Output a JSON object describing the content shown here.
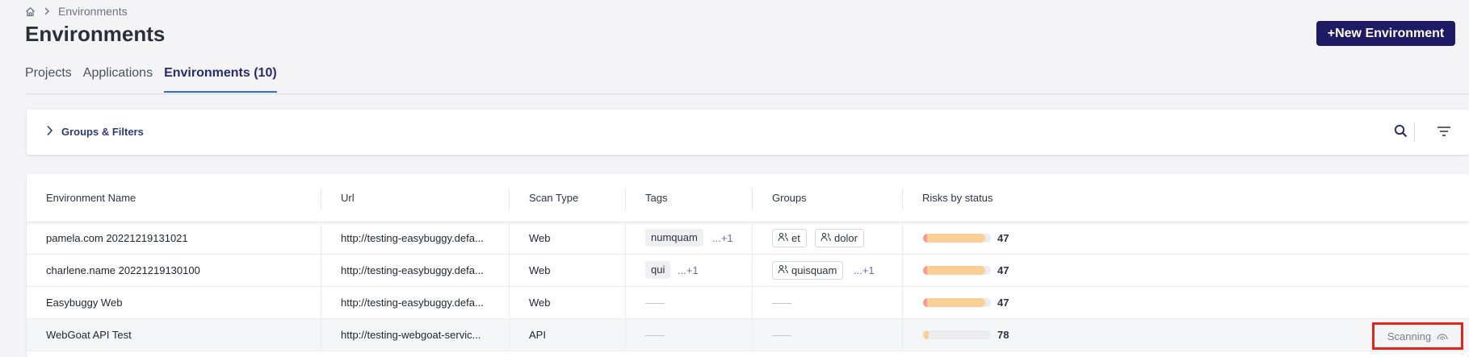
{
  "breadcrumb": {
    "current": "Environments"
  },
  "page": {
    "title": "Environments"
  },
  "toolbar": {
    "new_environment_label": "+New Environment"
  },
  "tabs": [
    {
      "label": "Projects",
      "active": false
    },
    {
      "label": "Applications",
      "active": false
    },
    {
      "label": "Environments (10)",
      "active": true
    }
  ],
  "filters": {
    "label": "Groups & Filters"
  },
  "table": {
    "columns": [
      "Environment Name",
      "Url",
      "Scan Type",
      "Tags",
      "Groups",
      "Risks by status"
    ],
    "rows": [
      {
        "name": "pamela.com 20221219131021",
        "url": "http://testing-easybuggy.defa...",
        "scan_type": "Web",
        "tags": [
          "numquam"
        ],
        "tags_more": "...+1",
        "groups": [
          "et",
          "dolor"
        ],
        "groups_more": "",
        "risk_fill": 0.92,
        "risk_red": 0.06,
        "risk_count": "47"
      },
      {
        "name": "charlene.name 20221219130100",
        "url": "http://testing-easybuggy.defa...",
        "scan_type": "Web",
        "tags": [
          "qui"
        ],
        "tags_more": "...+1",
        "groups": [
          "quisquam"
        ],
        "groups_more": "...+1",
        "risk_fill": 0.92,
        "risk_red": 0.06,
        "risk_count": "47"
      },
      {
        "name": "Easybuggy Web",
        "url": "http://testing-easybuggy.defa...",
        "scan_type": "Web",
        "tags": [],
        "tags_more": "",
        "groups": [],
        "groups_more": "",
        "risk_fill": 0.92,
        "risk_red": 0.06,
        "risk_count": "47"
      },
      {
        "name": "WebGoat API Test",
        "url": "http://testing-webgoat-servic...",
        "scan_type": "API",
        "tags": [],
        "tags_more": "",
        "groups": [],
        "groups_more": "",
        "risk_fill": 0.08,
        "risk_red": 0.0,
        "risk_count": "78",
        "status": "Scanning"
      }
    ]
  },
  "colors": {
    "primary_button": "#1e1a63",
    "active_tab_underline": "#2f6fd6",
    "risk_medium": "#f9cf97",
    "risk_high": "#f59a92",
    "highlight_box": "#e0251b"
  },
  "icons": [
    "home-icon",
    "chevron-right-icon",
    "plus-icon",
    "search-icon",
    "filter-icon",
    "group-icon",
    "scanning-icon"
  ]
}
